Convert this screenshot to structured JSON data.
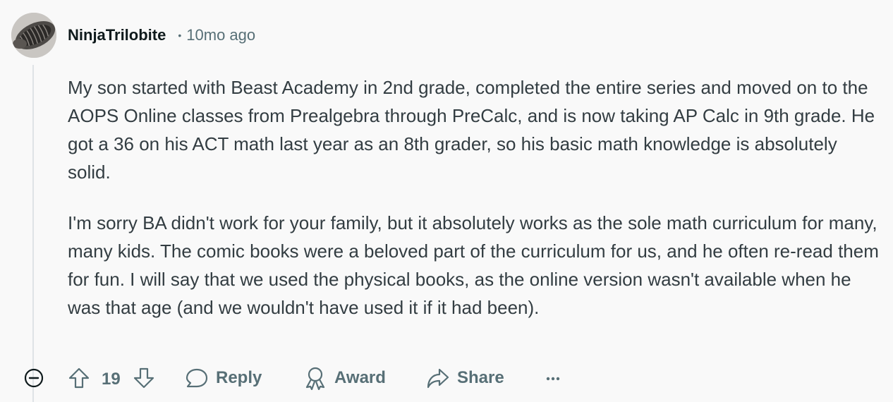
{
  "comment": {
    "username": "NinjaTrilobite",
    "separator": "•",
    "time_ago": "10mo ago",
    "paragraphs": [
      "My son started with Beast Academy in 2nd grade, completed the entire series and moved on to the AOPS Online classes from Prealgebra through PreCalc, and is now taking AP Calc in 9th grade. He got a 36 on his ACT math last year as an 8th grader, so his basic math knowledge is absolutely solid.",
      "I'm sorry BA didn't work for your family, but it absolutely works as the sole math curriculum for many, many kids. The comic books were a beloved part of the curriculum for us, and he often re-read them for fun. I will say that we used the physical books, as the online version wasn't available when he was that age (and we wouldn't have used it if it had been)."
    ]
  },
  "actions": {
    "vote_count": "19",
    "reply_label": "Reply",
    "award_label": "Award",
    "share_label": "Share",
    "more_label": "···"
  },
  "icons": {
    "collapse": "minus-circle-icon",
    "upvote": "arrow-up-icon",
    "downvote": "arrow-down-icon",
    "reply": "speech-bubble-icon",
    "award": "award-ribbon-icon",
    "share": "share-arrow-icon",
    "more": "ellipsis-icon"
  },
  "colors": {
    "background": "#f9f9f9",
    "username": "#0f1a1c",
    "body_text": "#333d42",
    "muted": "#576f76",
    "thread_line": "#dfe3e6"
  }
}
